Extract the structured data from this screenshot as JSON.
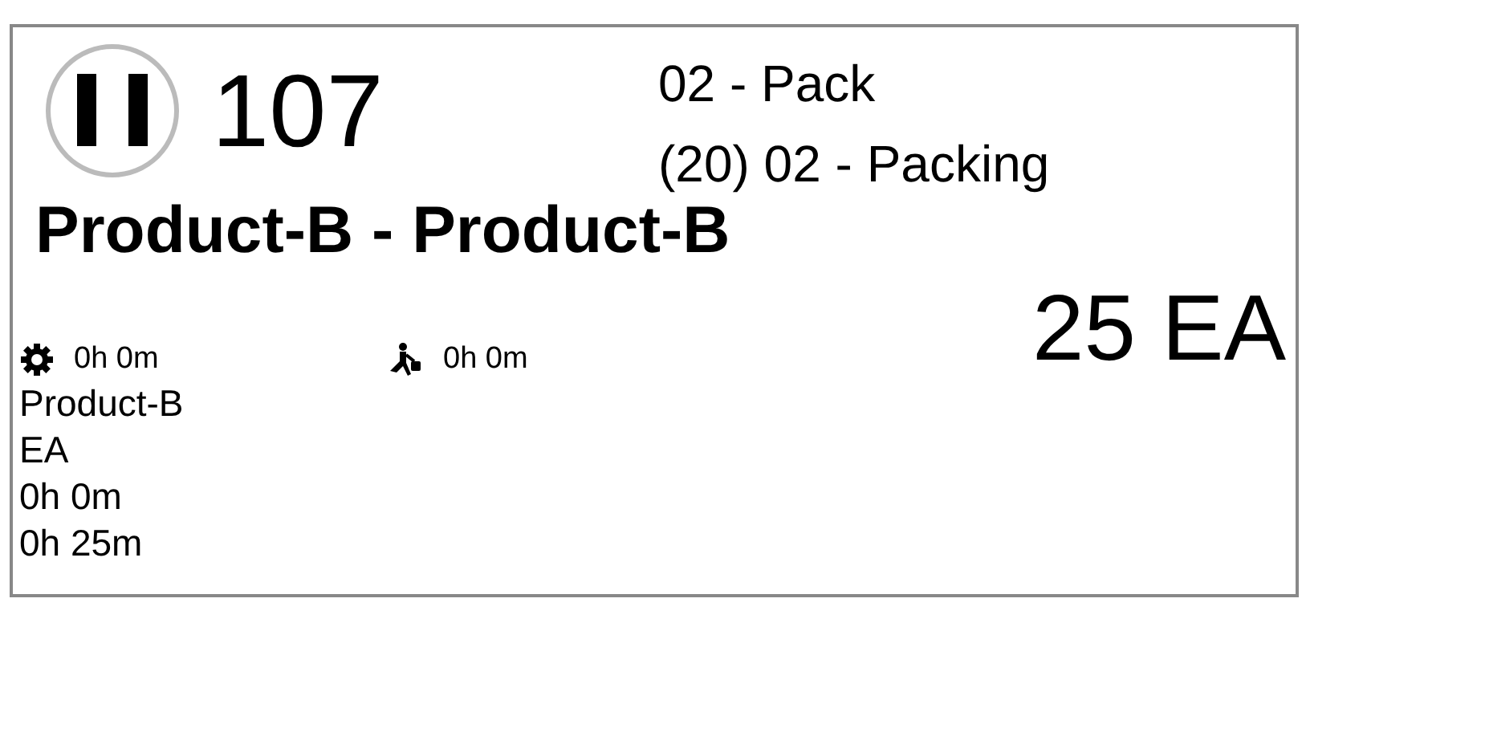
{
  "card": {
    "status": {
      "kind": "paused"
    },
    "number": "107",
    "operation": "02 - Pack",
    "step": "(20) 02 - Packing",
    "title": "Product-B - Product-B",
    "times": [
      {
        "kind": "setup",
        "value": "0h 0m"
      },
      {
        "kind": "labor",
        "value": "0h 0m"
      }
    ],
    "quantity": "25 EA",
    "details": [
      "Product-B",
      "EA",
      "0h 0m",
      "0h 25m"
    ]
  }
}
